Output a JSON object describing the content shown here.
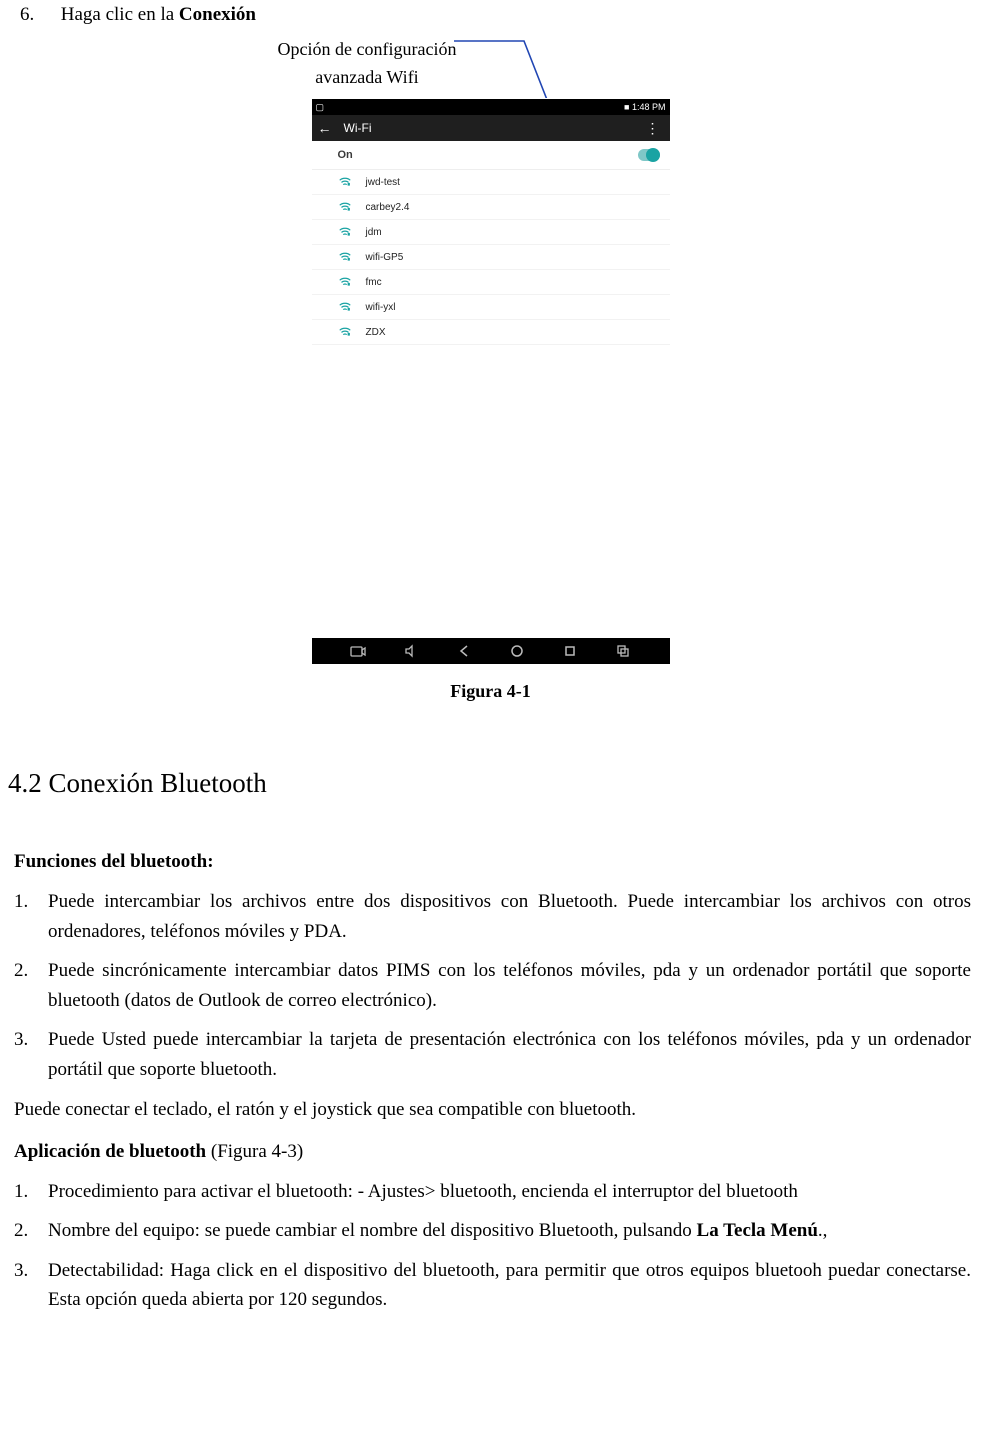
{
  "step6": {
    "num": "6.",
    "pre": "Haga clic en la ",
    "bold": "Conexión"
  },
  "anno": {
    "line1": "Opción de configuración",
    "line2": "avanzada Wifi"
  },
  "screenshot": {
    "status_left": "▢",
    "status_right": "■ 1:48 PM",
    "back": "←",
    "title": "Wi-Fi",
    "overflow": "⋮",
    "on_label": "On",
    "networks": [
      "jwd-test",
      "carbey2.4",
      "jdm",
      "wifi-GP5",
      "fmc",
      "wifi-yxl",
      "ZDX"
    ],
    "nav_icons": [
      "camera",
      "volume",
      "back",
      "home",
      "recent",
      "screenshot"
    ]
  },
  "fig_caption": "Figura    4-1",
  "section_heading": "4.2 Conexión Bluetooth",
  "funciones_head": "Funciones del bluetooth:",
  "funciones": [
    {
      "n": "1.",
      "t": "Puede intercambiar los archivos entre dos dispositivos con Bluetooth. Puede intercambiar los archivos con otros ordenadores, teléfonos móviles y PDA."
    },
    {
      "n": "2.",
      "t": "Puede sincrónicamente intercambiar datos PIMS con los teléfonos móviles, pda y un ordenador portátil que soporte bluetooth (datos de Outlook de correo electrónico)."
    },
    {
      "n": "3.",
      "t": "Puede Usted puede intercambiar la tarjeta de presentación electrónica con los teléfonos móviles, pda y un ordenador portátil que soporte bluetooth."
    }
  ],
  "para_keyboard": "Puede conectar el teclado, el ratón y el joystick que sea compatible con bluetooth.",
  "app_head_bold": "Aplicación de bluetooth",
  "app_head_rest": " (Figura 4-3)",
  "aplicacion": [
    {
      "n": "1.",
      "t": "Procedimiento para activar el bluetooth: - Ajustes> bluetooth,    encienda el interruptor del bluetooth"
    },
    {
      "n": "2.",
      "pre": "Nombre del equipo: se puede cambiar el nombre del dispositivo Bluetooth, pulsando ",
      "bold": "La Tecla Menú",
      "post": ".,"
    },
    {
      "n": "3.",
      "t": "Detectabilidad: Haga click en el dispositivo del bluetooth, para permitir que otros equipos bluetooh puedar conectarse. Esta opción queda abierta por 120 segundos."
    }
  ]
}
